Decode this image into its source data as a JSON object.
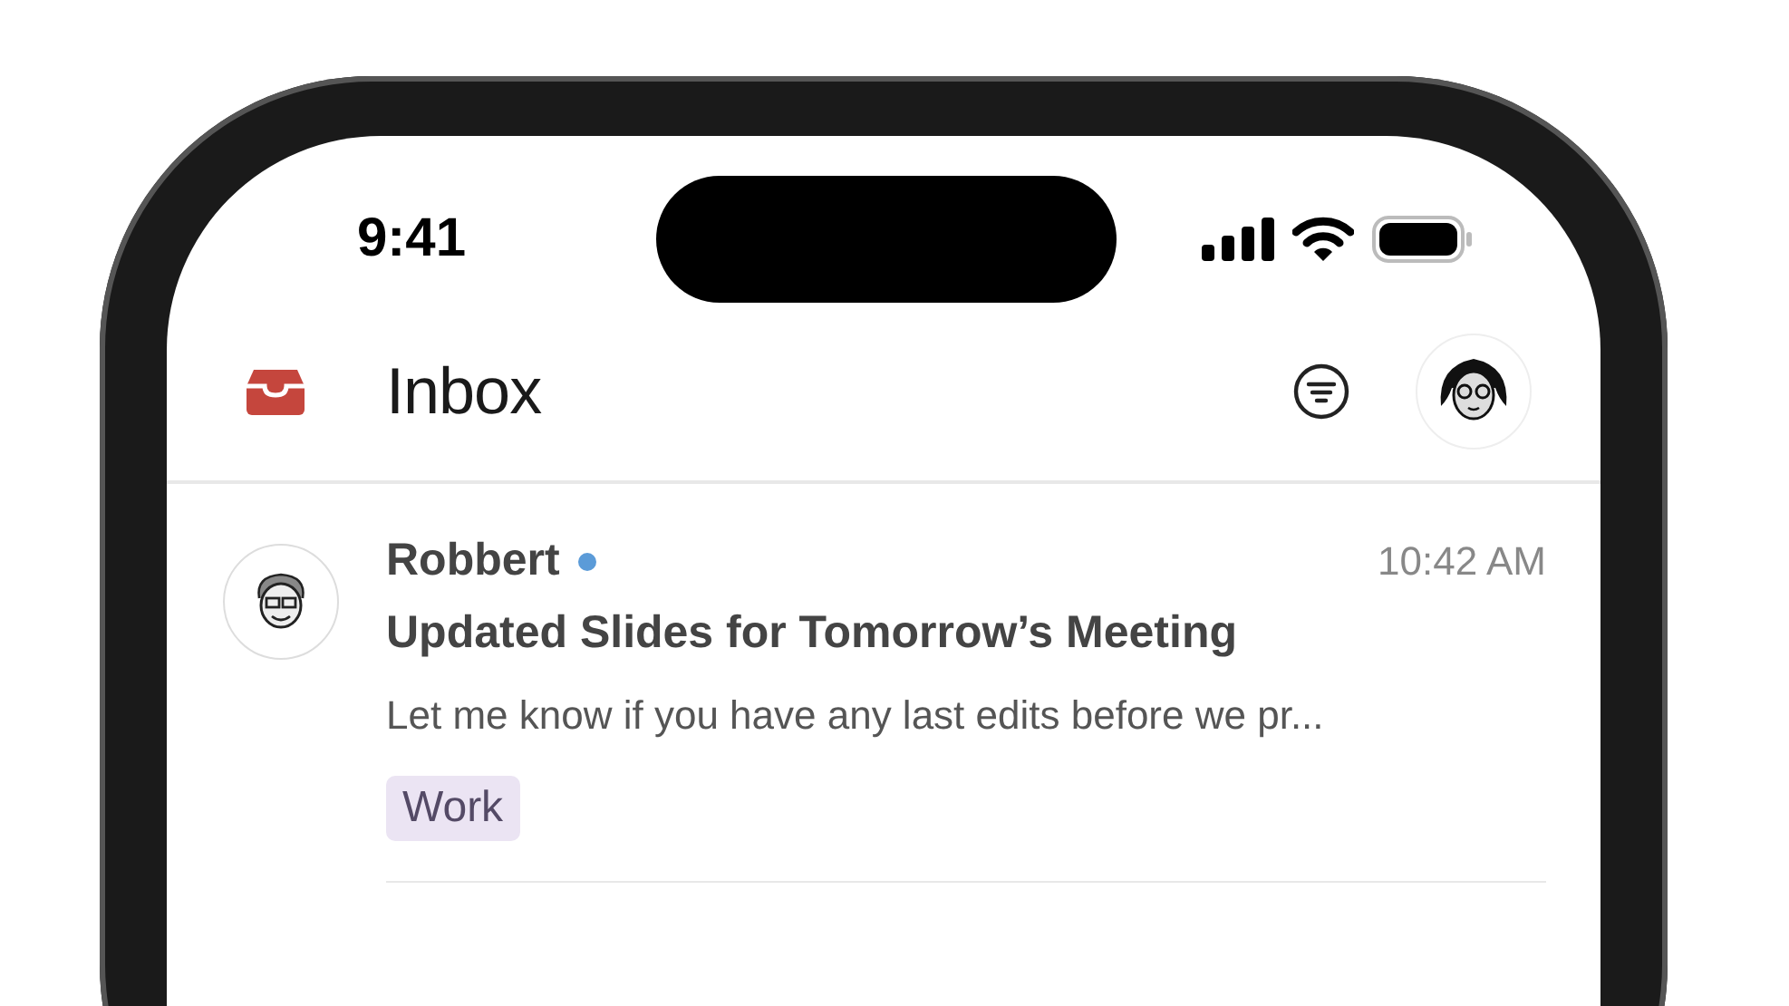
{
  "status_bar": {
    "time": "9:41"
  },
  "header": {
    "title": "Inbox"
  },
  "emails": [
    {
      "sender": "Robbert",
      "unread": true,
      "time": "10:42 AM",
      "subject": "Updated Slides for Tomorrow’s Meeting",
      "preview": "Let me know if you have any last edits before we pr...",
      "tags": [
        "Work"
      ]
    }
  ]
}
